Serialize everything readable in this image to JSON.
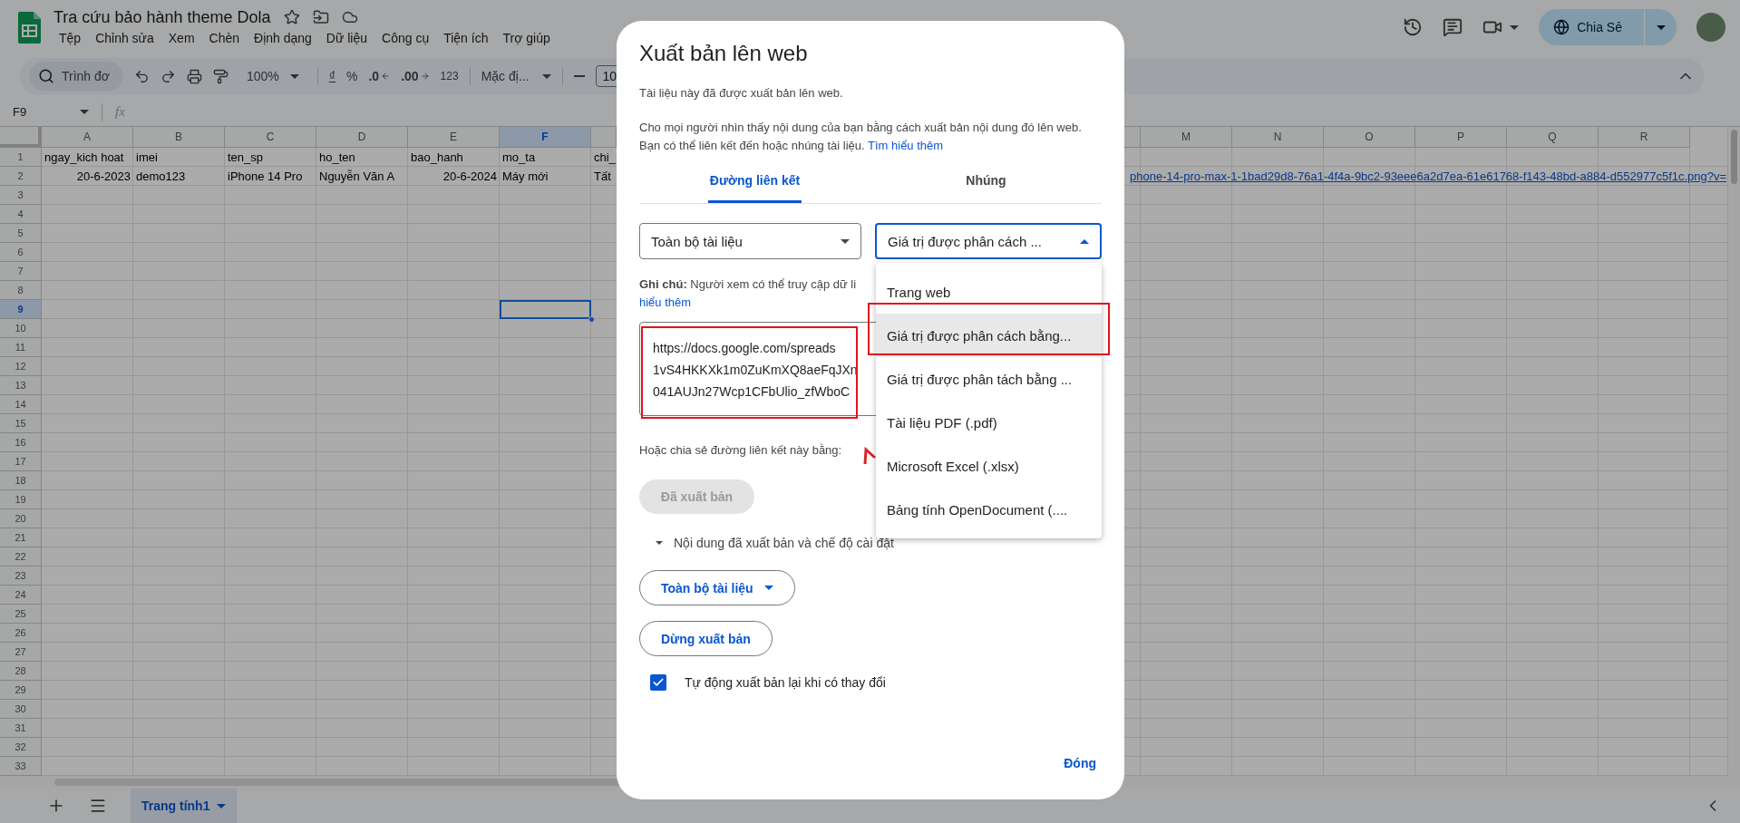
{
  "document": {
    "title": "Tra cứu bảo hành theme Dola"
  },
  "menu_bar": [
    "Tệp",
    "Chỉnh sửa",
    "Xem",
    "Chèn",
    "Định dạng",
    "Dữ liệu",
    "Công cụ",
    "Tiện ích",
    "Trợ giúp"
  ],
  "share_button": {
    "label": "Chia Sẻ"
  },
  "toolbar": {
    "search": {
      "placeholder": "Trình đơ"
    },
    "zoom": "100%",
    "currency": "₫",
    "percent": "%",
    "decrease_decimal": ".0",
    "increase_decimal": ".00",
    "number_format": "123",
    "font": "Mặc đị...",
    "font_size": "10"
  },
  "formula_bar": {
    "name_box": "F9",
    "function_label": "fx"
  },
  "grid": {
    "columns": [
      {
        "label": "A",
        "selected": false
      },
      {
        "label": "B",
        "selected": false
      },
      {
        "label": "C",
        "selected": false
      },
      {
        "label": "D",
        "selected": false
      },
      {
        "label": "E",
        "selected": false
      },
      {
        "label": "F",
        "selected": true
      },
      {
        "label": "M",
        "selected": false
      },
      {
        "label": "N",
        "selected": false
      },
      {
        "label": "O",
        "selected": false
      },
      {
        "label": "P",
        "selected": false
      },
      {
        "label": "Q",
        "selected": false
      },
      {
        "label": "R",
        "selected": false
      }
    ],
    "rows": [
      {
        "label": "1",
        "selected": false,
        "cells": [
          {
            "text": "ngay_kich hoat",
            "kind": "text"
          },
          {
            "text": "imei",
            "kind": "text"
          },
          {
            "text": "ten_sp",
            "kind": "text"
          },
          {
            "text": "ho_ten",
            "kind": "text"
          },
          {
            "text": "bao_hanh",
            "kind": "text"
          },
          {
            "text": "mo_ta",
            "kind": "text"
          },
          {
            "text": "chi_",
            "kind": "text"
          }
        ]
      },
      {
        "label": "2",
        "selected": false,
        "cells": [
          {
            "text": "20-6-2023",
            "kind": "number"
          },
          {
            "text": "demo123",
            "kind": "text"
          },
          {
            "text": "iPhone 14 Pro",
            "kind": "text"
          },
          {
            "text": "Nguyễn Văn A",
            "kind": "text"
          },
          {
            "text": "20-6-2024",
            "kind": "number"
          },
          {
            "text": "Máy mới",
            "kind": "text"
          },
          {
            "text": "Tất",
            "kind": "text"
          }
        ],
        "overflow_link": "phone-14-pro-max-1-1bad29d8-76a1-4f4a-9bc2-93eee6a2d7ea-61e61768-f143-48bd-a884-d552977c5f1c.png?v="
      },
      {
        "label": "3",
        "selected": false
      },
      {
        "label": "4",
        "selected": false
      },
      {
        "label": "5",
        "selected": false
      },
      {
        "label": "6",
        "selected": false
      },
      {
        "label": "7",
        "selected": false
      },
      {
        "label": "8",
        "selected": false
      },
      {
        "label": "9",
        "selected": true
      },
      {
        "label": "10",
        "selected": false
      },
      {
        "label": "11",
        "selected": false
      },
      {
        "label": "12",
        "selected": false
      },
      {
        "label": "13",
        "selected": false
      },
      {
        "label": "14",
        "selected": false
      },
      {
        "label": "15",
        "selected": false
      },
      {
        "label": "16",
        "selected": false
      },
      {
        "label": "17",
        "selected": false
      },
      {
        "label": "18",
        "selected": false
      },
      {
        "label": "19",
        "selected": false
      },
      {
        "label": "20",
        "selected": false
      },
      {
        "label": "21",
        "selected": false
      },
      {
        "label": "22",
        "selected": false
      },
      {
        "label": "23",
        "selected": false
      },
      {
        "label": "24",
        "selected": false
      },
      {
        "label": "25",
        "selected": false
      },
      {
        "label": "26",
        "selected": false
      },
      {
        "label": "27",
        "selected": false
      },
      {
        "label": "28",
        "selected": false
      },
      {
        "label": "29",
        "selected": false
      },
      {
        "label": "30",
        "selected": false
      },
      {
        "label": "31",
        "selected": false
      },
      {
        "label": "32",
        "selected": false
      },
      {
        "label": "33",
        "selected": false
      }
    ]
  },
  "sheet_tabs": [
    {
      "label": "Trang tính1",
      "selected": true
    }
  ],
  "dialog": {
    "title": "Xuất bản lên web",
    "status": "Tài liệu này đã được xuất bản lên web.",
    "description": "Cho mọi người nhìn thấy nội dung của bạn bằng cách xuất bản nội dung đó lên web. Bạn có thể liên kết đến hoặc nhúng tài liệu.",
    "learn_more_link": "Tìm hiểu thêm",
    "tabs": [
      {
        "label": "Đường liên kết",
        "selected": true
      },
      {
        "label": "Nhúng",
        "selected": false
      }
    ],
    "scope_select": {
      "value": "Toàn bộ tài liệu"
    },
    "format_select": {
      "value": "Giá trị được phân cách ...",
      "expanded": true
    },
    "format_options": [
      {
        "label": "Trang web",
        "selected": false
      },
      {
        "label": "Giá trị được phân cách bằng...",
        "selected": true
      },
      {
        "label": "Giá trị được phân tách bằng ...",
        "selected": false
      },
      {
        "label": "Tài liệu PDF (.pdf)",
        "selected": false
      },
      {
        "label": "Microsoft Excel (.xlsx)",
        "selected": false
      },
      {
        "label": "Bảng tính OpenDocument (....",
        "selected": false
      }
    ],
    "note": "**Ghi chú:** Người xem có thể truy cập dữ li",
    "note_link": "hiểu thêm",
    "link_lines": [
      "https://docs.google.com/spreads",
      "1vS4HKKXk1m0ZuKmXQ8aeFqJXn",
      "041AUJn27Wcp1CFbUlio_zfWboC"
    ],
    "share_label": "Hoặc chia sẻ đường liên kết này bằng:",
    "publish_button": {
      "label": "Đã xuất bản",
      "disabled": true
    },
    "settings_section": {
      "label": "Nội dung đã xuất bản và chế độ cài đặt",
      "expanded": true
    },
    "scope_button": {
      "label": "Toàn bộ tài liệu"
    },
    "stop_button": {
      "label": "Dừng xuất bản"
    },
    "auto_republish": {
      "label": "Tự động xuất bản lại khi có thay đổi",
      "checked": true
    },
    "close_button": {
      "label": "Đóng"
    }
  }
}
